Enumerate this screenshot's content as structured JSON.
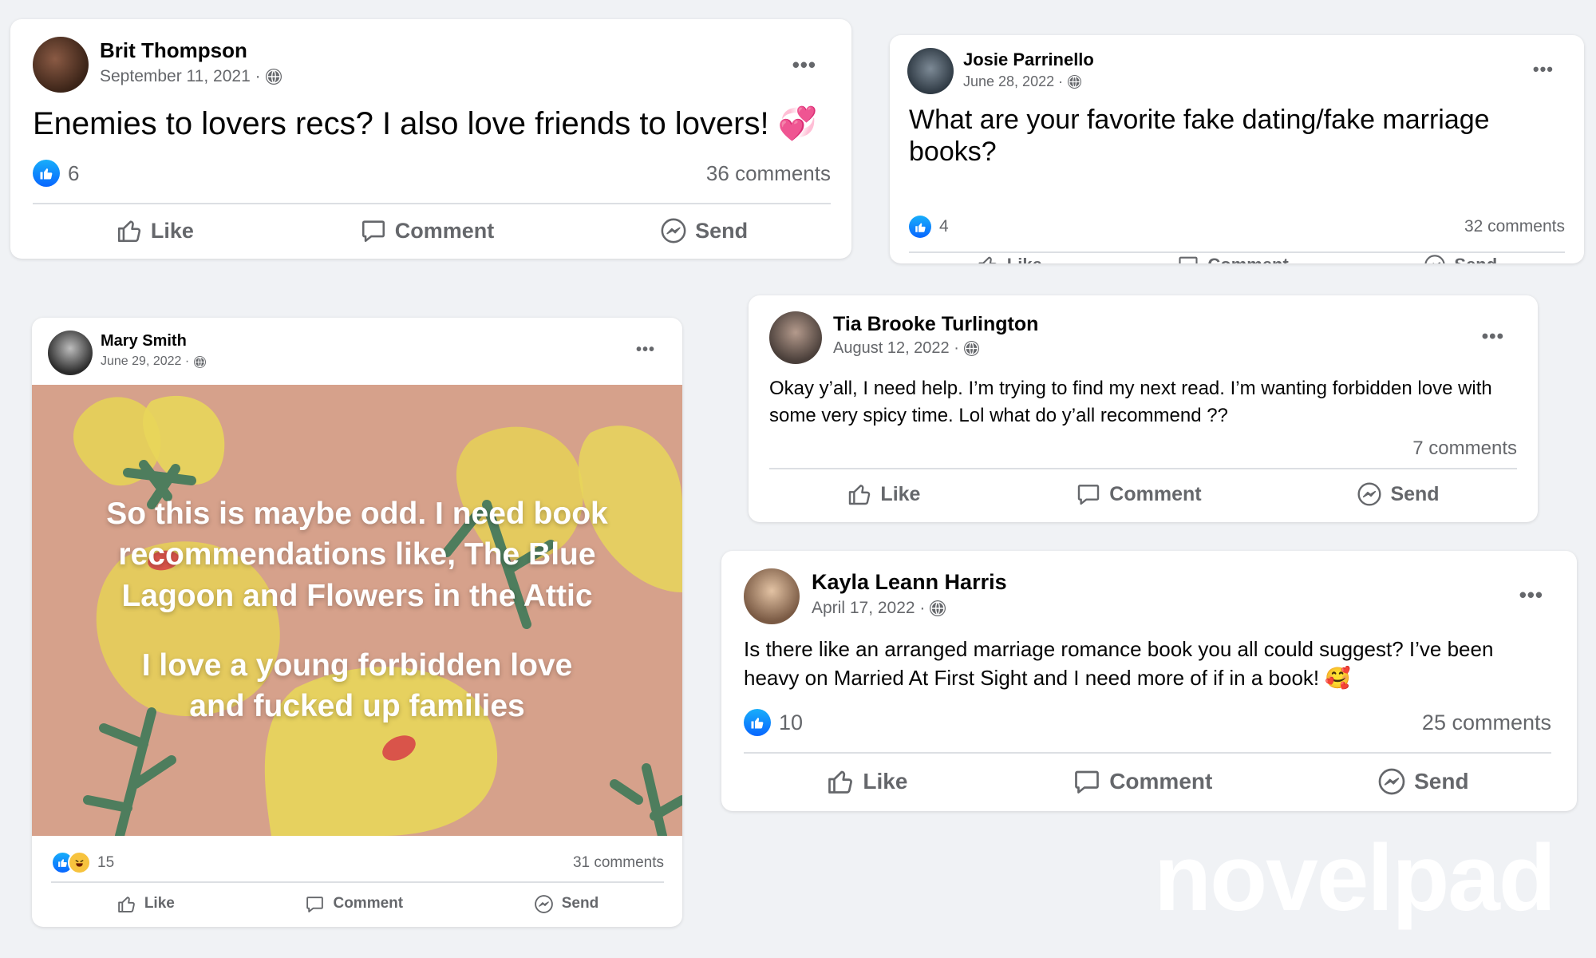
{
  "posts": [
    {
      "author": "Brit Thompson",
      "date": "September 11, 2021 ·",
      "text": "Enemies to lovers recs? I also love friends to lovers! 💞",
      "reactions": "6",
      "comments": "36 comments"
    },
    {
      "author": "Josie Parrinello",
      "date": "June 28, 2022 ·",
      "text": "What are your favorite fake dating/fake marriage books?",
      "reactions": "4",
      "comments": "32 comments"
    },
    {
      "author": "Mary Smith",
      "date": "June 29, 2022 ·",
      "image_text_1": "So this is maybe odd. I need book recommendations like, The Blue Lagoon and Flowers in the Attic",
      "image_text_2": "I love a young forbidden love and fucked up families",
      "reactions": "15",
      "comments": "31 comments"
    },
    {
      "author": "Tia Brooke Turlington",
      "date": "August 12, 2022 ·",
      "text": "Okay y’all, I need help. I’m trying to find my next read. I’m wanting forbidden love with some very spicy time. Lol what do y’all recommend ??",
      "comments": "7 comments"
    },
    {
      "author": "Kayla Leann Harris",
      "date": "April 17, 2022 ·",
      "text": "Is there like an arranged marriage romance book you all could suggest? I’ve been heavy on Married At First Sight and I need more of if in a book! 🥰",
      "reactions": "10",
      "comments": "25 comments"
    }
  ],
  "actions": {
    "like": "Like",
    "comment": "Comment",
    "send": "Send"
  },
  "menu": "•••",
  "watermark": "novelpad",
  "colors": {
    "background": "#f0f2f5",
    "card": "#ffffff",
    "secondary_text": "#65676b",
    "like_blue": "#0866ff",
    "image_bg": "#d6a18b"
  },
  "icons": [
    "globe-icon",
    "like-icon",
    "comment-icon",
    "send-messenger-icon",
    "more-options-icon",
    "thumbs-up-reaction-icon",
    "haha-reaction-icon"
  ]
}
